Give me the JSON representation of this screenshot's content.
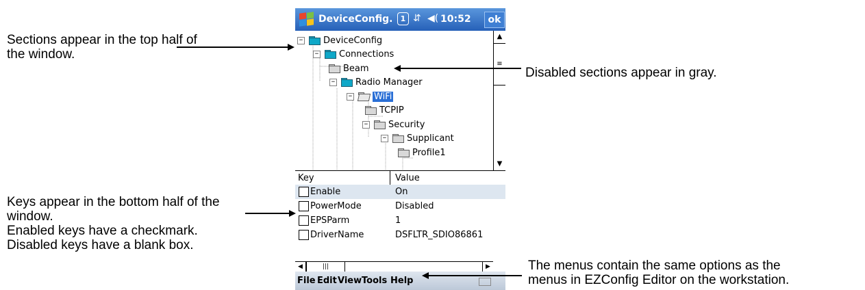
{
  "callouts": {
    "sections": [
      "Sections appear in the top half of",
      "the window."
    ],
    "disabled_sections": "Disabled sections appear in gray.",
    "keys": [
      "Keys appear in the bottom half of the",
      "window.",
      "Enabled keys have a checkmark.",
      "Disabled keys have a blank box."
    ],
    "menus": [
      "The menus contain the same options as the",
      "menus in EZConfig Editor on the workstation."
    ]
  },
  "titlebar": {
    "title": "DeviceConfig.",
    "notification": "1",
    "connectivity_icon": "⇵",
    "volume_icon": "◀(",
    "time": "10:52",
    "ok_label": "ok"
  },
  "tree": {
    "nodes": [
      {
        "label": "DeviceConfig",
        "expander": "−",
        "folder": "blue"
      },
      {
        "label": "Connections",
        "expander": "−",
        "folder": "blue"
      },
      {
        "label": "Beam",
        "expander": "",
        "folder": "gray"
      },
      {
        "label": "Radio Manager",
        "expander": "−",
        "folder": "blue"
      },
      {
        "label": "WiFi",
        "expander": "−",
        "folder": "open",
        "selected": true
      },
      {
        "label": "TCPIP",
        "expander": "",
        "folder": "gray"
      },
      {
        "label": "Security",
        "expander": "−",
        "folder": "gray"
      },
      {
        "label": "Supplicant",
        "expander": "−",
        "folder": "gray"
      },
      {
        "label": "Profile1",
        "expander": "",
        "folder": "gray"
      }
    ]
  },
  "table": {
    "col_key": "Key",
    "col_value": "Value",
    "rows": [
      {
        "key": "Enable",
        "value": "On",
        "enabled": false
      },
      {
        "key": "PowerMode",
        "value": "Disabled",
        "enabled": false
      },
      {
        "key": "EPSParm",
        "value": "1",
        "enabled": false
      },
      {
        "key": "DriverName",
        "value": "DSFLTR_SDIO86861",
        "enabled": false
      }
    ]
  },
  "menubar": {
    "file": "File",
    "edit": "Edit",
    "view": "View",
    "tools": "Tools",
    "help": "Help"
  },
  "colors": {
    "titlebar": "#2660b8",
    "selection": "#2a6fd6",
    "enabled_folder": "#0fa8c8",
    "disabled_folder": "#d8d8d8",
    "row_highlight": "#dde6f0"
  }
}
